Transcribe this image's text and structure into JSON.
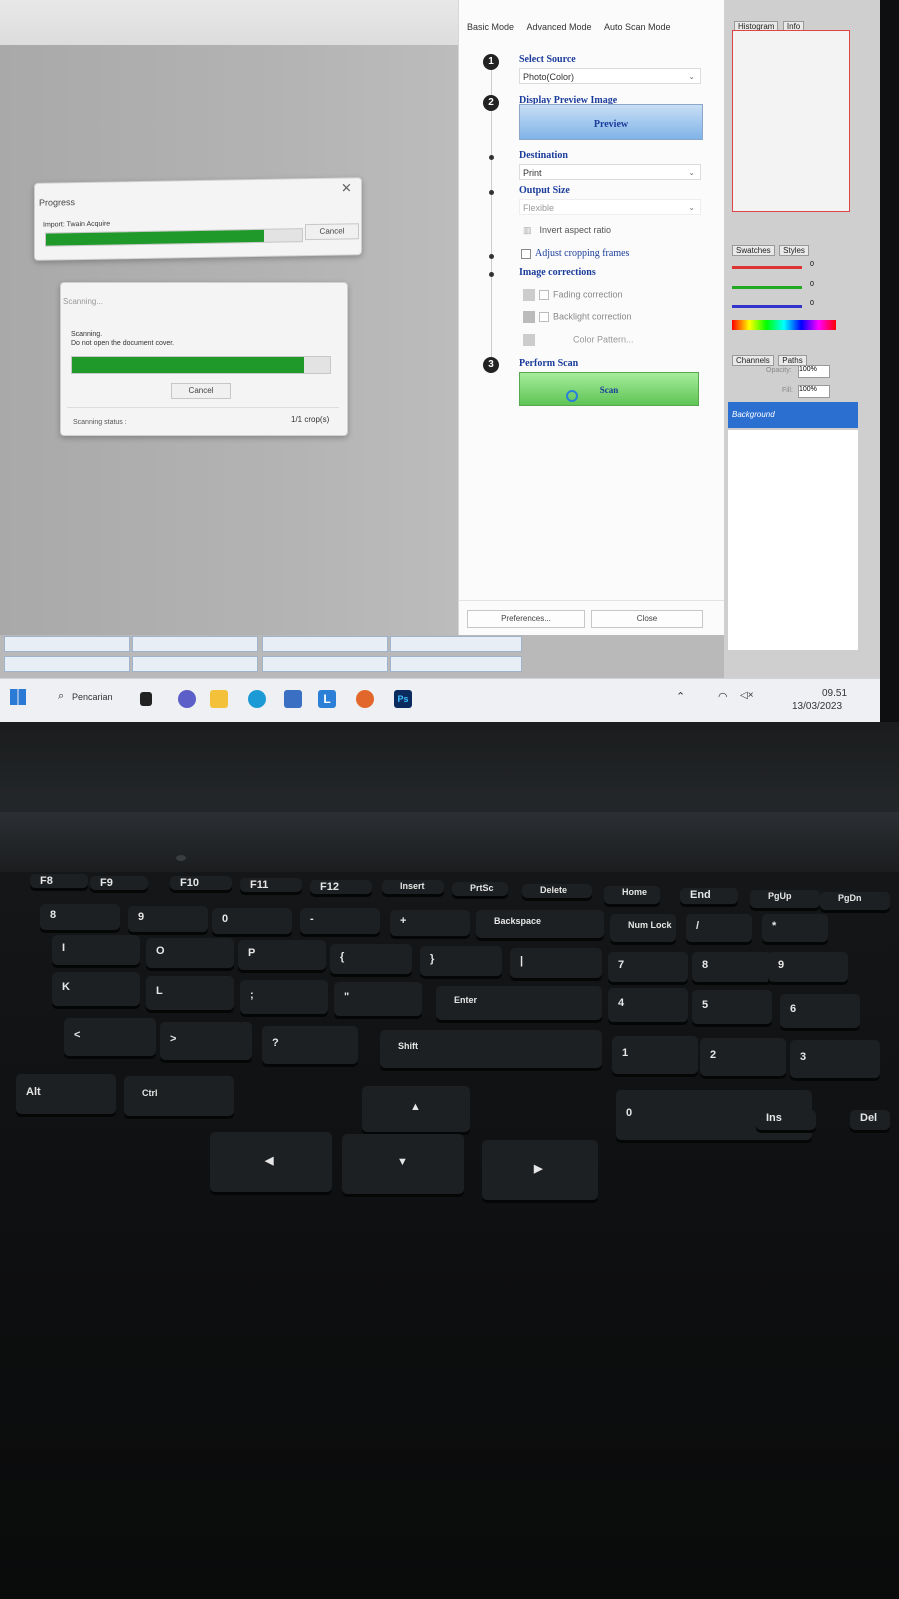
{
  "progress_dialog": {
    "title": "Progress",
    "status": "Import: Twain Acquire",
    "cancel_label": "Cancel",
    "progress": 0.85
  },
  "scanning_dialog": {
    "title": "Scanning...",
    "line1": "Scanning.",
    "line2": "Do not open the document cover.",
    "cancel_label": "Cancel",
    "status_label": "Scanning status :",
    "crop_count": "1/1 crop(s)",
    "progress": 0.9
  },
  "scanner": {
    "tabs": [
      "Basic Mode",
      "Advanced Mode",
      "Auto Scan Mode"
    ],
    "step1_num": "1",
    "step1_label": "Select Source",
    "source_value": "Photo(Color)",
    "step2_num": "2",
    "step2_label": "Display Preview Image",
    "preview_label": "Preview",
    "destination_label": "Destination",
    "destination_value": "Print",
    "output_size_label": "Output Size",
    "output_size_value": "Flexible",
    "invert_label": "Invert aspect ratio",
    "adjust_label": "Adjust cropping frames",
    "corrections_label": "Image corrections",
    "fading_label": "Fading correction",
    "backlight_label": "Backlight correction",
    "color_pattern_label": "Color Pattern...",
    "step3_num": "3",
    "step3_label": "Perform Scan",
    "scan_label": "Scan",
    "preferences_label": "Preferences...",
    "close_label": "Close"
  },
  "photoshop": {
    "tab_histogram": "Histogram",
    "tab_info": "Info",
    "tab_swatches": "Swatches",
    "tab_styles": "Styles",
    "slider_values": [
      "0",
      "0",
      "0"
    ],
    "tab_channels": "Channels",
    "tab_paths": "Paths",
    "opacity_label": "Opacity:",
    "opacity_value": "100%",
    "fill_label": "Fill:",
    "fill_value": "100%",
    "layer_name": "Background"
  },
  "taskbar": {
    "search_label": "Pencarian",
    "time": "09.51",
    "date": "13/03/2023",
    "ps_label": "Ps",
    "l_label": "L"
  },
  "keyboard": {
    "keys": [
      "F8",
      "F9",
      "F10",
      "F11",
      "F12",
      "Insert",
      "PrtSc",
      "Delete",
      "Home",
      "End",
      "PgUp",
      "PgDn",
      "8",
      "9",
      "0",
      "-",
      "+",
      "Backspace",
      "Num Lock",
      "/",
      "*",
      "I",
      "O",
      "P",
      "{",
      "}",
      "|",
      "7",
      "8",
      "9",
      "K",
      "L",
      ";",
      "\"",
      "Enter",
      "4",
      "5",
      "6",
      "<",
      ">",
      "?",
      "Shift",
      "1",
      "2",
      "3",
      "Alt",
      "Ctrl",
      "0",
      "Ins",
      "Del",
      "Home",
      "PgUp",
      "End",
      "PgDn"
    ]
  },
  "colors": {
    "green": "#1f9a2a",
    "preview_blue": "#7fb3e8",
    "scan_green": "#76d86a",
    "label_blue": "#1a3c9b",
    "layer_blue": "#2b6fd1"
  }
}
